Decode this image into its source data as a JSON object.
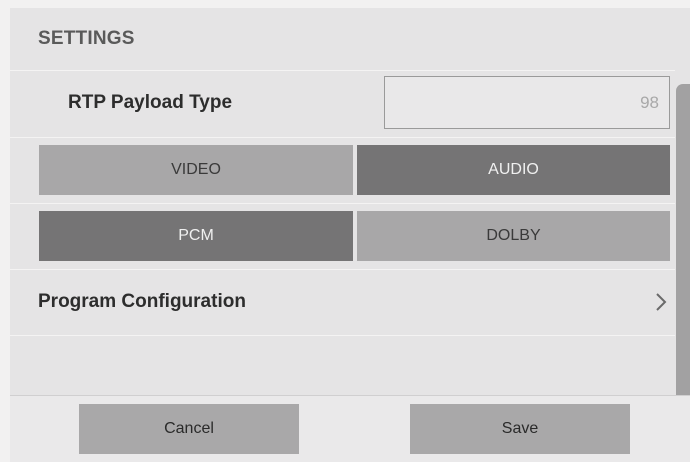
{
  "header": {
    "title": "SETTINGS"
  },
  "payload": {
    "label": "RTP Payload Type",
    "value": "98"
  },
  "media_toggle": {
    "options": [
      "VIDEO",
      "AUDIO"
    ],
    "selected": "AUDIO"
  },
  "codec_toggle": {
    "options": [
      "PCM",
      "DOLBY"
    ],
    "selected": "PCM"
  },
  "program": {
    "label": "Program Configuration",
    "icon": "chevron-right-icon"
  },
  "footer": {
    "cancel_label": "Cancel",
    "save_label": "Save"
  },
  "colors": {
    "panel_bg": "#e5e4e5",
    "segment_selected": "#757475",
    "segment_unselected": "#a8a7a8",
    "button_bg": "#a9a8a9"
  }
}
